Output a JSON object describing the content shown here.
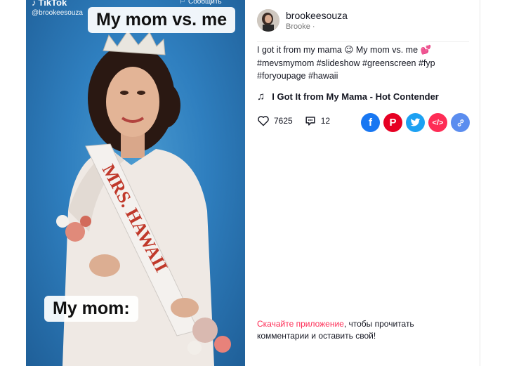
{
  "video": {
    "brand": "TikTok",
    "handle": "@brookeesouza",
    "report_label": "Сообщить",
    "caption_top": "My mom vs. me",
    "caption_bottom": "My mom:",
    "sash_text": "MRS. HAWAII"
  },
  "author": {
    "username": "brookeesouza",
    "display_name": "Brooke ·"
  },
  "post": {
    "description_line1": "I got it from my mama 😉 My mom vs. me 💕",
    "hashtags_line2": "#mevsmymom #slideshow #greenscreen #fyp",
    "hashtags_line3": "#foryoupage #hawaii",
    "music_title": "I Got It from My Mama - Hot Contender"
  },
  "stats": {
    "likes": "7625",
    "comments": "12"
  },
  "share": {
    "facebook_color": "#1877f2",
    "pinterest_color": "#e60023",
    "twitter_color": "#1da1f2",
    "embed_color": "#fe2c55",
    "link_color": "#5b8def"
  },
  "cta": {
    "link_text": "Скачайте приложение",
    "rest_text": ", чтобы прочитать комментарии и оставить свой!"
  }
}
